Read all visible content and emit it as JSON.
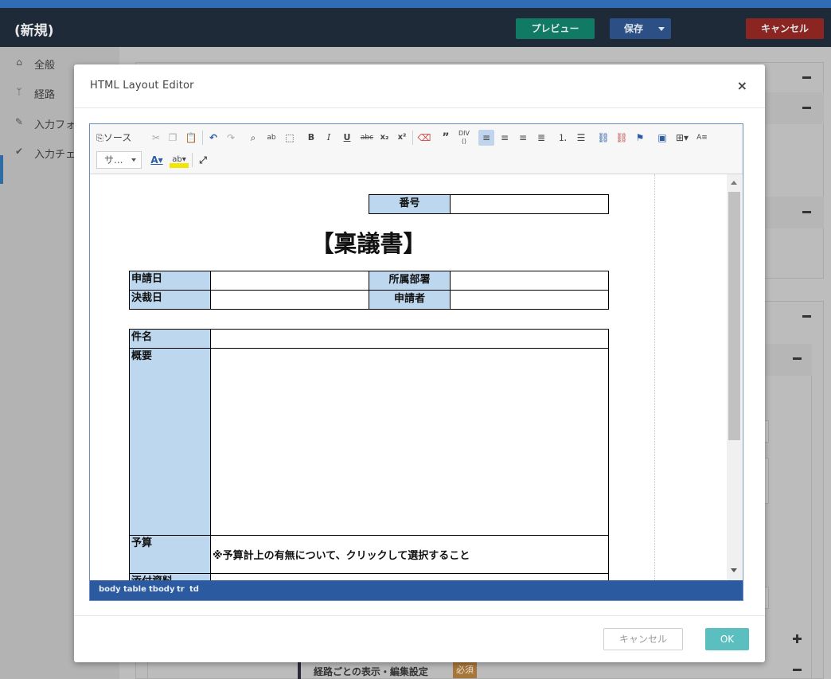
{
  "app": {
    "title": "(新規)",
    "buttons": {
      "preview": "プレビュー",
      "save": "保存",
      "cancel": "キャンセル"
    }
  },
  "sidebar": {
    "items": [
      {
        "label": "全般",
        "icon": "home-icon"
      },
      {
        "label": "経路",
        "icon": "route-icon"
      },
      {
        "label": "入力フォ",
        "icon": "pencil-icon"
      },
      {
        "label": "入力チェ",
        "icon": "check-icon"
      }
    ]
  },
  "background": {
    "bottom_row_label": "経路ごとの表示・編集設定",
    "required_badge": "必須"
  },
  "modal": {
    "title": "HTML Layout Editor",
    "close": "×",
    "cancel": "キャンセル",
    "ok": "OK"
  },
  "toolbar": {
    "source_label": "ソース",
    "font_size_value": "サ...",
    "icons": [
      "source-icon",
      "cut-icon",
      "copy-icon",
      "paste-icon",
      "undo-icon",
      "redo-icon",
      "find-icon",
      "replace-icon",
      "select-all-icon",
      "bold-icon",
      "italic-icon",
      "underline-icon",
      "strike-icon",
      "subscript-icon",
      "superscript-icon",
      "remove-format-icon",
      "blockquote-icon",
      "div-icon",
      "align-left-icon",
      "align-center-icon",
      "align-right-icon",
      "align-justify-icon",
      "numbered-list-icon",
      "bulleted-list-icon",
      "link-icon",
      "unlink-icon",
      "anchor-icon",
      "image-icon",
      "table-icon",
      "paragraph-format-icon",
      "text-color-icon",
      "background-color-icon",
      "maximize-icon"
    ]
  },
  "document": {
    "title": "【稟議書】",
    "labels": {
      "number": "番号",
      "application_date": "申請日",
      "department": "所属部署",
      "approval_date": "決裁日",
      "applicant": "申請者",
      "subject": "件名",
      "summary": "概要",
      "budget": "予算",
      "attachments": "添付資料"
    },
    "budget_note": "※予算計上の有無について、クリックして選択すること"
  },
  "statusbar": {
    "path": [
      "body",
      "table",
      "tbody",
      "tr",
      "td"
    ]
  }
}
